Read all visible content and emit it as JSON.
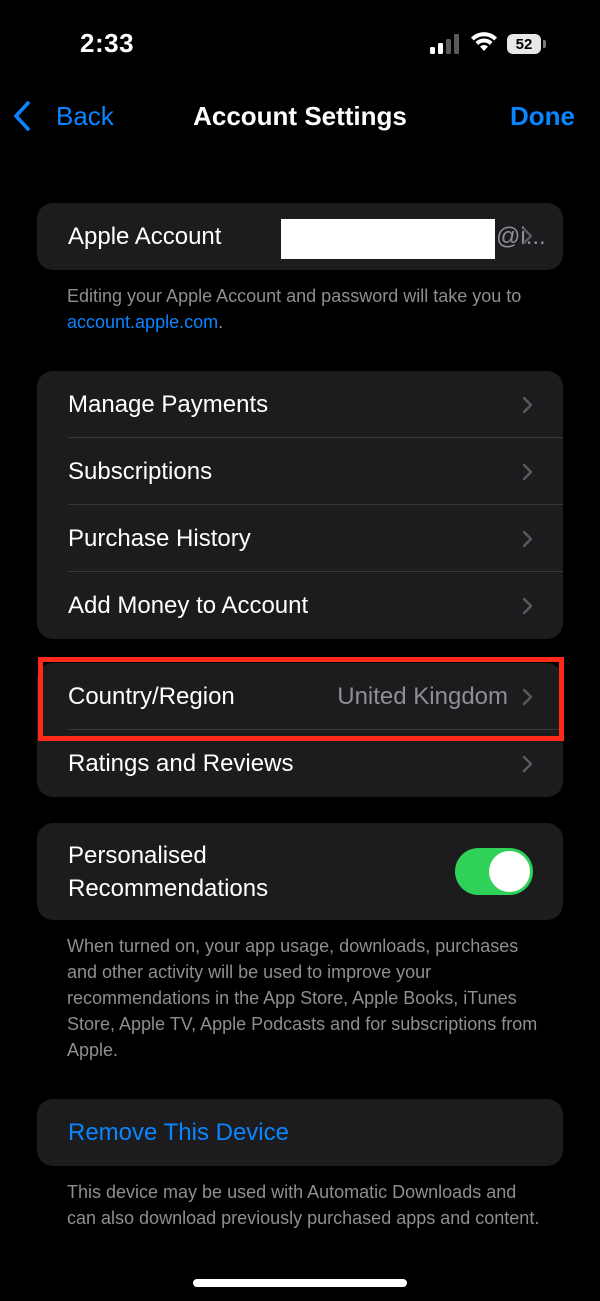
{
  "status_bar": {
    "time": "2:33",
    "battery": "52",
    "signal_icon": "cellular-signal-icon",
    "wifi_icon": "wifi-icon"
  },
  "nav": {
    "back_label": "Back",
    "title": "Account Settings",
    "done_label": "Done"
  },
  "account": {
    "label": "Apple Account",
    "email_suffix": "@i...",
    "note_prefix": "Editing your Apple Account and password will take you to ",
    "note_link": "account.apple.com",
    "note_suffix": "."
  },
  "payments_group": {
    "items": [
      {
        "label": "Manage Payments"
      },
      {
        "label": "Subscriptions"
      },
      {
        "label": "Purchase History"
      },
      {
        "label": "Add Money to Account"
      }
    ]
  },
  "region_group": {
    "country_label": "Country/Region",
    "country_value": "United Kingdom",
    "ratings_label": "Ratings and Reviews"
  },
  "recommendations": {
    "label_line1": "Personalised",
    "label_line2": "Recommendations",
    "enabled": true,
    "toggle_color": "#30d158",
    "note": "When turned on, your app usage, downloads, purchases and other activity will be used to improve your recommendations in the App Store, Apple Books, iTunes Store, Apple TV, Apple Podcasts and for subscriptions from Apple."
  },
  "device": {
    "remove_label": "Remove This Device",
    "note": "This device may be used with Automatic Downloads and can also download previously purchased apps and content."
  },
  "colors": {
    "accent": "#0a84ff",
    "highlight": "#ff2a1a",
    "group_bg": "#1c1c1e"
  }
}
